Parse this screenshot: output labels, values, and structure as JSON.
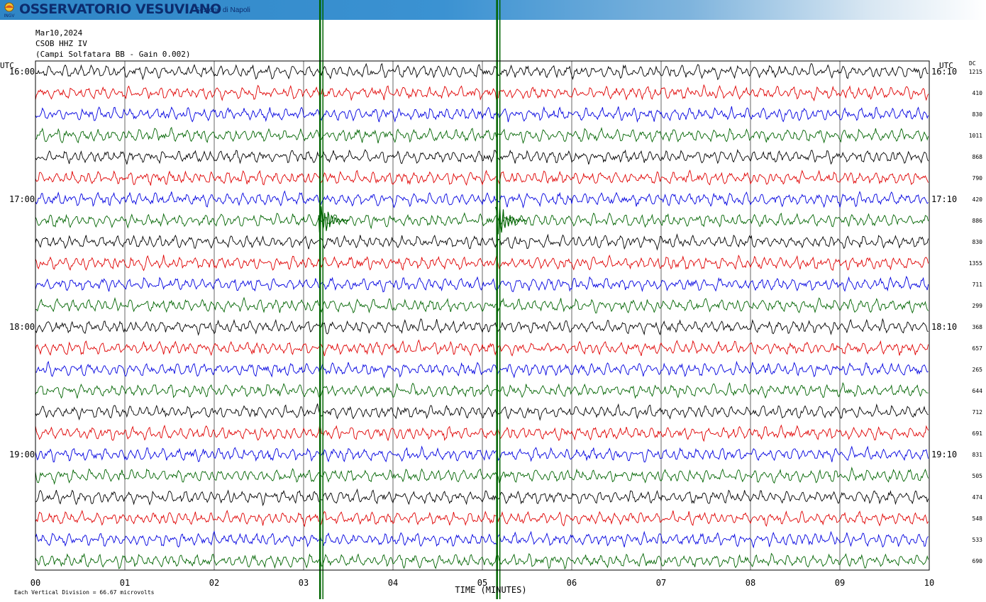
{
  "header": {
    "logo_text": "INGV",
    "org_name": "OSSERVATORIO VESUVIANO",
    "department": "Sezione di Napoli"
  },
  "info": {
    "date": "Mar10,2024",
    "station": "CSOB HHZ IV",
    "description": "(Campi Solfatara BB - Gain 0.002)"
  },
  "colors": {
    "trace_cycle": [
      "#000000",
      "#e00000",
      "#0000e0",
      "#006400"
    ],
    "event": "#006400",
    "banner": "#3b92d2"
  },
  "chart_data": {
    "type": "line",
    "title": "",
    "xlabel": "TIME (MINUTES)",
    "x_ticks": [
      "00",
      "01",
      "02",
      "03",
      "04",
      "05",
      "06",
      "07",
      "08",
      "09",
      "10"
    ],
    "xlim": [
      0,
      10
    ],
    "left_axis_label": "UTC",
    "right_axis_label": "UTC",
    "dc_label": "DC",
    "left_time_labels": [
      {
        "row": 0,
        "text": "16:00"
      },
      {
        "row": 6,
        "text": "17:00"
      },
      {
        "row": 12,
        "text": "18:00"
      },
      {
        "row": 18,
        "text": "19:00"
      }
    ],
    "right_time_labels": [
      {
        "row": 0,
        "text": "16:10"
      },
      {
        "row": 6,
        "text": "17:10"
      },
      {
        "row": 12,
        "text": "18:10"
      },
      {
        "row": 18,
        "text": "19:10"
      }
    ],
    "dc_values": [
      "1215",
      "410",
      "830",
      "1011",
      "868",
      "790",
      "420",
      "886",
      "830",
      "1355",
      "711",
      "299",
      "368",
      "657",
      "265",
      "644",
      "712",
      "691",
      "831",
      "505",
      "474",
      "548",
      "533",
      "690"
    ],
    "minutes_per_line": 10,
    "rows": 24,
    "events": [
      {
        "row": 7,
        "minute": 3.2
      },
      {
        "row": 7,
        "minute": 5.18
      }
    ],
    "footer_note": "Each Vertical Division =   66.67 microvolts"
  }
}
